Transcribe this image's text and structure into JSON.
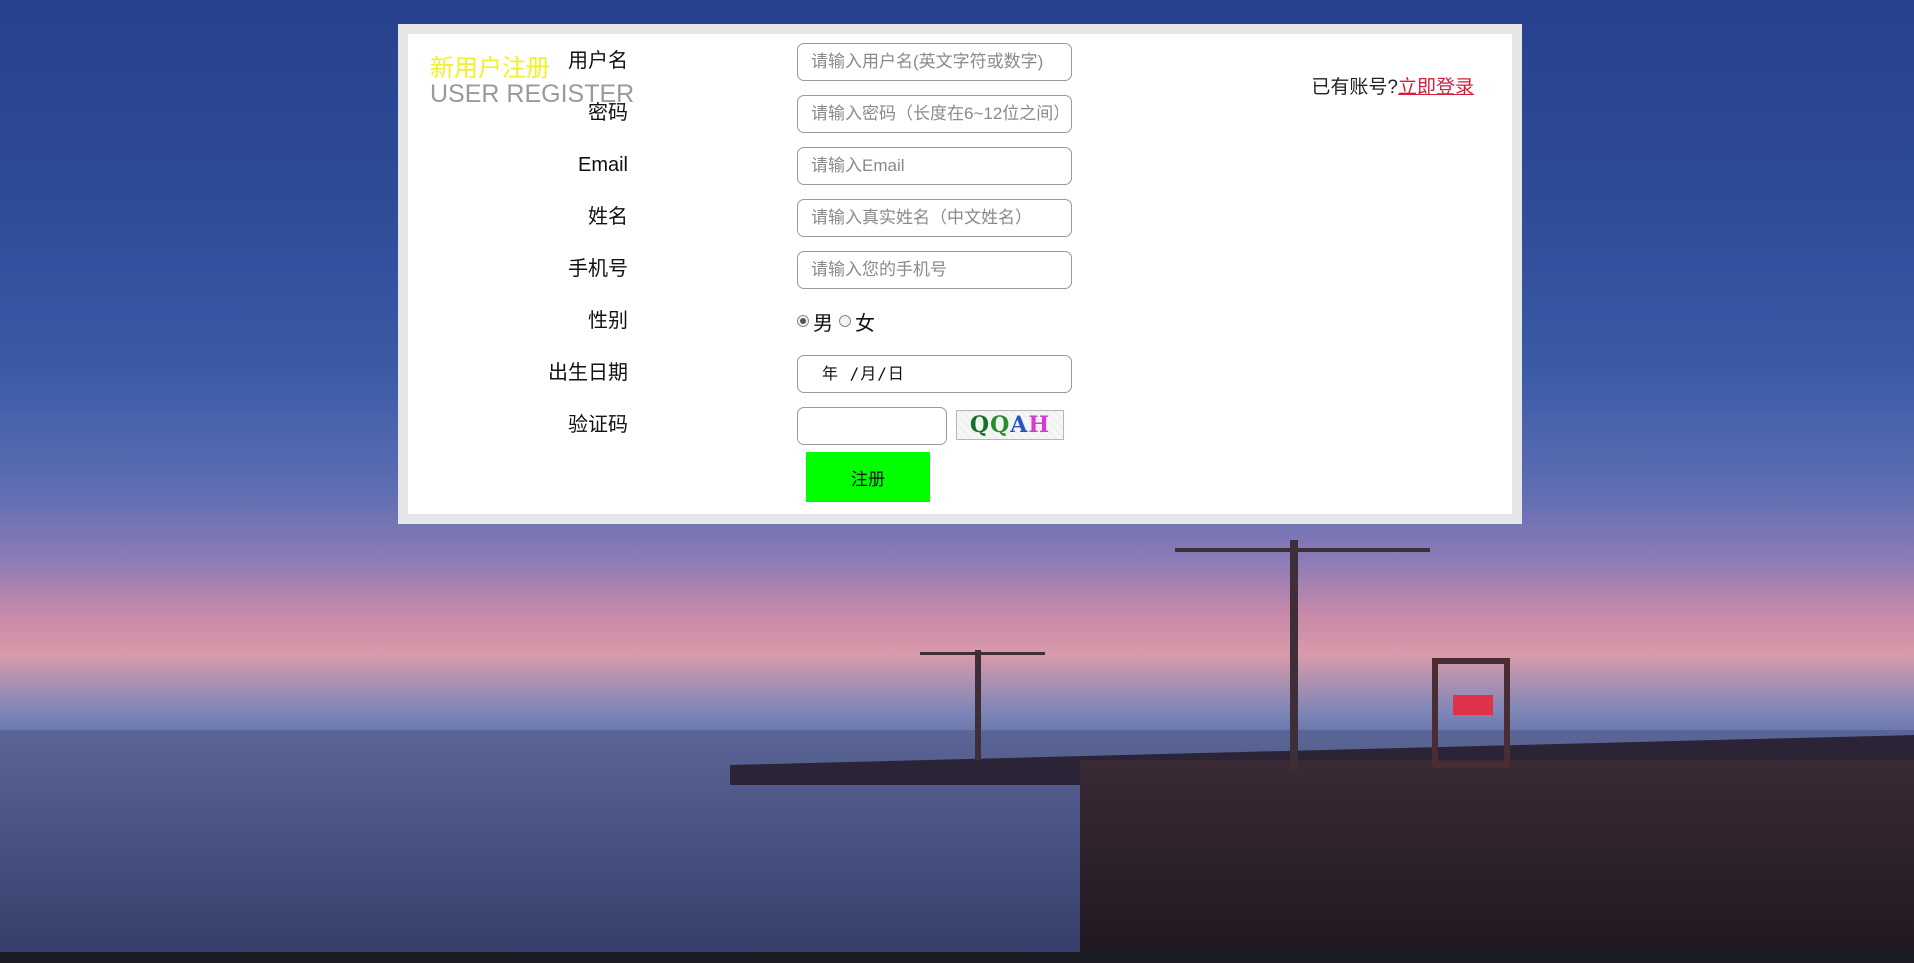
{
  "form": {
    "title_cn": "新用户注册",
    "title_en": "USER REGISTER",
    "login_hint": "已有账号?",
    "login_link": "立即登录",
    "fields": {
      "username": {
        "label": "用户名",
        "placeholder": "请输入用户名(英文字符或数字)",
        "value": ""
      },
      "password": {
        "label": "密码",
        "placeholder": "请输入密码（长度在6~12位之间）",
        "value": ""
      },
      "email": {
        "label": "Email",
        "placeholder": "请输入Email",
        "value": ""
      },
      "name": {
        "label": "姓名",
        "placeholder": "请输入真实姓名（中文姓名）",
        "value": ""
      },
      "phone": {
        "label": "手机号",
        "placeholder": "请输入您的手机号",
        "value": ""
      },
      "gender": {
        "label": "性别",
        "options": [
          "男",
          "女"
        ],
        "selected": "男"
      },
      "birthday": {
        "label": "出生日期",
        "display": "年 /月/日"
      },
      "captcha": {
        "label": "验证码",
        "value": "",
        "image_text": "QQAH"
      }
    },
    "submit_label": "注册"
  },
  "colors": {
    "title_cn": "#f3ef2a",
    "title_en": "#9a9a9a",
    "login_link": "#d21f3c",
    "submit_bg": "#00ff00",
    "panel_border": "#e6e6e6"
  }
}
